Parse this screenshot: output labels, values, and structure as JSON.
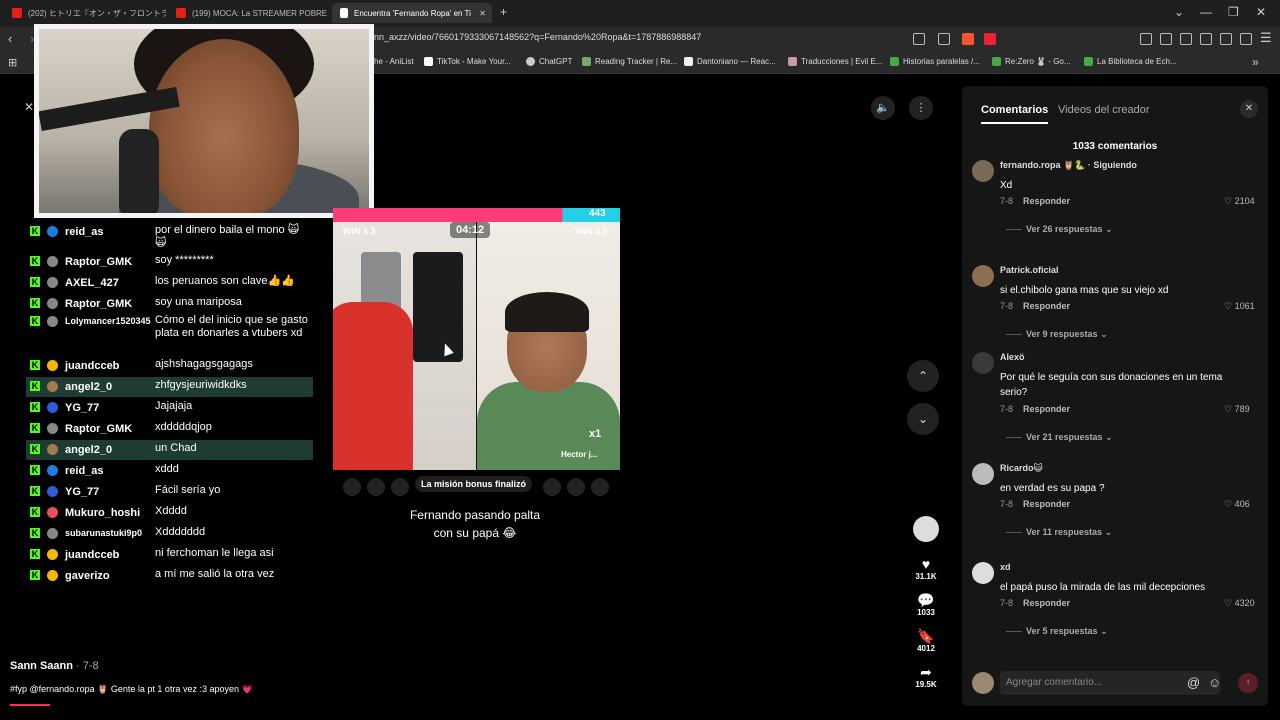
{
  "browser": {
    "tabs": [
      {
        "title": "(202) ヒトリエ『オン・ザ・フロントライン』- Y",
        "color": "#e62117"
      },
      {
        "title": "(199) MOCA: La STREAMER POBRE M",
        "color": "#e62117"
      },
      {
        "title": "Encuentra 'Fernando Ropa' en Ti",
        "color": "#ffffff"
      }
    ],
    "new_tab": "+",
    "url": "nn_axzz/video/7660179333067148562?q=Fernando%20Ropa&t=1787886988847",
    "bookmarks": [
      "he - AniList",
      "TikTok - Make Your...",
      "ChatGPT",
      "Reading Tracker | Re...",
      "Dantoniano — Reac...",
      "Traducciones | Evil E...",
      "Historias paralelas /...",
      "Re:Zero 🐰 - Go...",
      "La Biblioteca de Ech..."
    ]
  },
  "chat": [
    {
      "user": "reid_as",
      "text": "por el dinero baila el mono 🙀🙀",
      "highlight": false,
      "color": "#1e7be0"
    },
    {
      "user": "Raptor_GMK",
      "text": "soy *********",
      "highlight": false,
      "color": "#888"
    },
    {
      "user": "AXEL_427",
      "text": "los peruanos son clave👍👍",
      "highlight": false,
      "color": "#888"
    },
    {
      "user": "Raptor_GMK",
      "text": "soy una mariposa",
      "highlight": false,
      "color": "#888"
    },
    {
      "user": "Lolymancer1520345",
      "text": "Cómo el del inicio que se gasto plata en donarles a vtubers xd",
      "highlight": false,
      "color": "#888"
    },
    {
      "user": "juandcceb",
      "text": "ajshshagagsgagags",
      "highlight": false,
      "color": "#f5b800"
    },
    {
      "user": "angel2_0",
      "text": "zhfgysjeuriwidkdks",
      "highlight": true,
      "color": "#a37b4f"
    },
    {
      "user": "YG_77",
      "text": "Jajajaja",
      "highlight": false,
      "color": "#2f5dd8"
    },
    {
      "user": "Raptor_GMK",
      "text": "xdddddqjop",
      "highlight": false,
      "color": "#888"
    },
    {
      "user": "angel2_0",
      "text": "un Chad",
      "highlight": true,
      "color": "#a37b4f"
    },
    {
      "user": "reid_as",
      "text": "xddd",
      "highlight": false,
      "color": "#1e7be0"
    },
    {
      "user": "YG_77",
      "text": "Fácil sería yo",
      "highlight": false,
      "color": "#2f5dd8"
    },
    {
      "user": "Mukuro_hoshi",
      "text": "Xdddd",
      "highlight": false,
      "color": "#e8515b"
    },
    {
      "user": "subarunastuki9p0",
      "text": "Xddddddd",
      "highlight": false,
      "color": "#888"
    },
    {
      "user": "juandcceb",
      "text": "ni ferchoman le llega asi",
      "highlight": false,
      "color": "#f5b800"
    },
    {
      "user": "gaverizo",
      "text": "a mí me salió la otra vez",
      "highlight": false,
      "color": "#f5b800"
    }
  ],
  "video": {
    "score_top": "443",
    "timer": "04:12",
    "win_left": "WIN x 3",
    "win_right": "WIN x 0",
    "multiplier": "x1",
    "right_name": "Hector j...",
    "mission": "La misión bonus finalizó",
    "caption": "Fernando pasando palta con su papá 😂"
  },
  "rail": {
    "likes": "31.1K",
    "comments": "1033",
    "saves": "4012",
    "shares": "19.5K"
  },
  "post": {
    "author": "Sann Saann",
    "author_date": "· 7-8",
    "description": "#fyp @fernando.ropa 🦉 Gente la pt 1 otra vez :3 apoyen 💗"
  },
  "comments": {
    "tab_comments": "Comentarios",
    "tab_creator": "Videos del creador",
    "count": "1033 comentarios",
    "input_placeholder": "Agregar comentario...",
    "items": [
      {
        "user": "fernando.ropa 🦉🐍 · Siguiendo",
        "text": "Xd",
        "date": "7-8",
        "reply": "Responder",
        "likes": "2104",
        "replies": "Ver 26 respuestas",
        "avatar": "#7a6a55"
      },
      {
        "user": "Patrick.oficial",
        "text": "si el.chibolo gana mas que su viejo xd",
        "date": "7-8",
        "reply": "Responder",
        "likes": "1061",
        "replies": "Ver 9 respuestas",
        "avatar": "#8a7050"
      },
      {
        "user": "Alexö",
        "text": "Por qué le seguía con sus donaciones en un tema serio?",
        "date": "7-8",
        "reply": "Responder",
        "likes": "789",
        "replies": "Ver 21 respuestas",
        "avatar": "#3a3a3a"
      },
      {
        "user": "Ricardo😺",
        "text": "en verdad es su papa ?",
        "date": "7-8",
        "reply": "Responder",
        "likes": "406",
        "replies": "Ver 11 respuestas",
        "avatar": "#bbbbbb"
      },
      {
        "user": "xd",
        "text": "el papá puso la mirada de las mil decepciones",
        "date": "7-8",
        "reply": "Responder",
        "likes": "4320",
        "replies": "Ver 5 respuestas",
        "avatar": "#dddddd"
      }
    ]
  }
}
